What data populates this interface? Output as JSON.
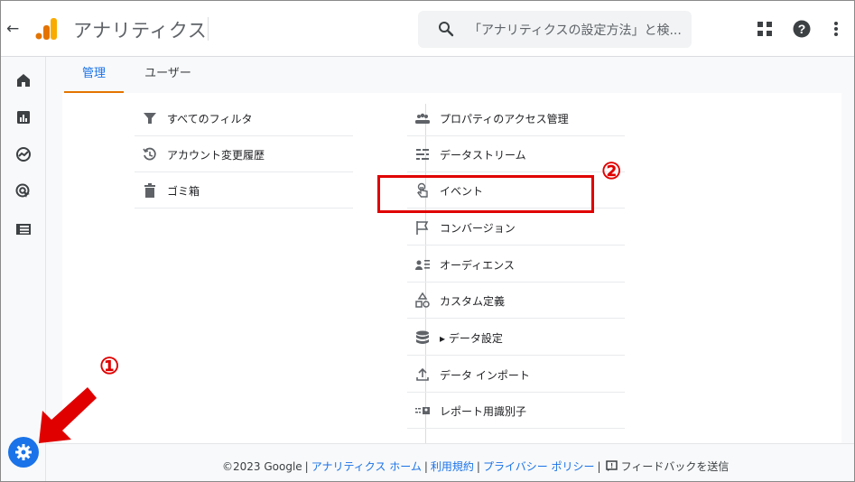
{
  "header": {
    "back_glyph": "←",
    "app_title": "アナリティクス",
    "search_placeholder": "「アナリティクスの設定方法」と検...",
    "icons": [
      "back-icon",
      "analytics-logo",
      "search-icon",
      "apps-icon",
      "help-icon",
      "more-vert-icon"
    ]
  },
  "rail": {
    "icons": [
      "home-icon",
      "reports-icon",
      "explore-icon",
      "advertising-icon",
      "list-icon",
      "settings-icon"
    ]
  },
  "tabs": [
    {
      "label": "管理",
      "active": true
    },
    {
      "label": "ユーザー",
      "active": false
    }
  ],
  "left_menu": [
    {
      "label": "すべてのフィルタ",
      "icon": "filter-icon"
    },
    {
      "label": "アカウント変更履歴",
      "icon": "history-icon"
    },
    {
      "label": "ゴミ箱",
      "icon": "trash-icon"
    }
  ],
  "right_menu": [
    {
      "label": "プロパティのアクセス管理",
      "icon": "people-icon"
    },
    {
      "label": "データストリーム",
      "icon": "data-stream-icon"
    },
    {
      "label": "イベント",
      "icon": "touch-icon"
    },
    {
      "label": "コンバージョン",
      "icon": "flag-icon"
    },
    {
      "label": "オーディエンス",
      "icon": "audience-icon"
    },
    {
      "label": "カスタム定義",
      "icon": "shapes-icon"
    },
    {
      "label": "▸ データ設定",
      "icon": "database-icon"
    },
    {
      "label": "データ インポート",
      "icon": "upload-icon"
    },
    {
      "label": "レポート用識別子",
      "icon": "identifier-icon"
    }
  ],
  "annotations": {
    "callout_1": "①",
    "callout_2": "②",
    "highlight_color": "#e00000"
  },
  "footer": {
    "copyright": "©2023 Google",
    "links": [
      "アナリティクス ホーム",
      "利用規約",
      "プライバシー ポリシー"
    ],
    "feedback": "フィードバックを送信"
  },
  "colors": {
    "accent": "#1a73e8",
    "tab_underline": "#e37400",
    "logo_orange": "#f9ab00",
    "logo_dark_orange": "#e37400"
  }
}
